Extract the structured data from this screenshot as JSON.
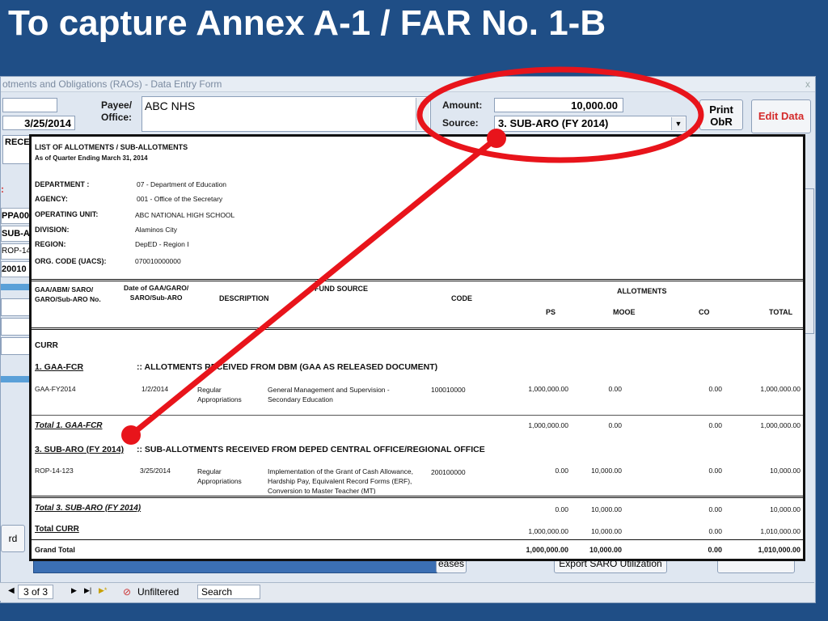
{
  "slide": {
    "title": "To capture Annex A-1 / FAR No. 1-B"
  },
  "form": {
    "window_title": "otments and Obligations (RAOs) - Data Entry Form",
    "close_glyph": "x",
    "date_value": "3/25/2014",
    "payee_label": "Payee/\nOffice:",
    "payee_value": "ABC NHS",
    "amount_label": "Amount:",
    "amount_value": "10,000.00",
    "source_label": "Source:",
    "source_value": "3. SUB-ARO (FY 2014)",
    "print_obr_label": "Print ObR",
    "edit_data_label": "Edit Data",
    "rece_text": "RECE",
    "left_strip": [
      "PPA00",
      "SUB-AI",
      "ROP-14-",
      "20010"
    ],
    "asterisk": ":",
    "record_btn": "rd",
    "releases_btn": "eases",
    "export_btn": "Export SARO Utilization"
  },
  "statusbar": {
    "record_nav": "3 of 3",
    "filter": "Unfiltered",
    "search": "Search"
  },
  "report": {
    "title": "LIST OF ALLOTMENTS / SUB-ALLOTMENTS",
    "subtitle": "As of Quarter Ending March 31, 2014",
    "meta": [
      {
        "label": "DEPARTMENT :",
        "value": "07 - Department of Education"
      },
      {
        "label": "AGENCY:",
        "value": "001 - Office of the Secretary"
      },
      {
        "label": "OPERATING UNIT:",
        "value": "ABC NATIONAL HIGH SCHOOL"
      },
      {
        "label": "DIVISION:",
        "value": "Alaminos City"
      },
      {
        "label": "REGION:",
        "value": "DepED - Region I"
      },
      {
        "label": "ORG. CODE (UACS):",
        "value": "070010000000"
      }
    ],
    "headers": {
      "col1": "GAA/ABM/ SARO/\nGARO/Sub-ARO No.",
      "col2": "Date of GAA/GARO/\nSARO/Sub-ARO",
      "col3": "DESCRIPTION",
      "col4": "FUND SOURCE",
      "col5": "CODE",
      "allotments": "ALLOTMENTS",
      "ps": "PS",
      "mooe": "MOOE",
      "co": "CO",
      "total": "TOTAL"
    },
    "curr": "CURR",
    "sec1": {
      "code": "1. GAA-FCR",
      "desc": ":: ALLOTMENTS RECEIVED FROM DBM (GAA AS RELEASED DOCUMENT)"
    },
    "row1": {
      "no": "GAA-FY2014",
      "date": "1/2/2014",
      "fund": "Regular\nAppropriations",
      "desc": "General Management and Supervision -\nSecondary Education",
      "code": "100010000",
      "ps": "1,000,000.00",
      "mooe": "0.00",
      "co": "0.00",
      "total": "1,000,000.00"
    },
    "total1": {
      "label": "Total 1. GAA-FCR",
      "ps": "1,000,000.00",
      "mooe": "0.00",
      "co": "0.00",
      "total": "1,000,000.00"
    },
    "sec3": {
      "code": "3. SUB-ARO (FY 2014)",
      "desc": ":: SUB-ALLOTMENTS RECEIVED FROM DEPED CENTRAL OFFICE/REGIONAL OFFICE"
    },
    "row3": {
      "no": "ROP-14-123",
      "date": "3/25/2014",
      "fund": "Regular\nAppropriations",
      "desc": "Implementation of the Grant of Cash Allowance,\nHardship Pay, Equivalent Record Forms (ERF),\nConversion to Master Teacher (MT)",
      "code": "200100000",
      "ps": "0.00",
      "mooe": "10,000.00",
      "co": "0.00",
      "total": "10,000.00"
    },
    "total3": {
      "label": "Total 3. SUB-ARO (FY 2014)",
      "ps": "0.00",
      "mooe": "10,000.00",
      "co": "0.00",
      "total": "10,000.00"
    },
    "totalcurr": {
      "label": "Total CURR",
      "ps": "1,000,000.00",
      "mooe": "10,000.00",
      "co": "0.00",
      "total": "1,010,000.00"
    },
    "grand": {
      "label": "Grand Total",
      "ps": "1,000,000.00",
      "mooe": "10,000.00",
      "co": "0.00",
      "total": "1,010,000.00"
    }
  },
  "annotation": {
    "color": "#e8141b"
  }
}
